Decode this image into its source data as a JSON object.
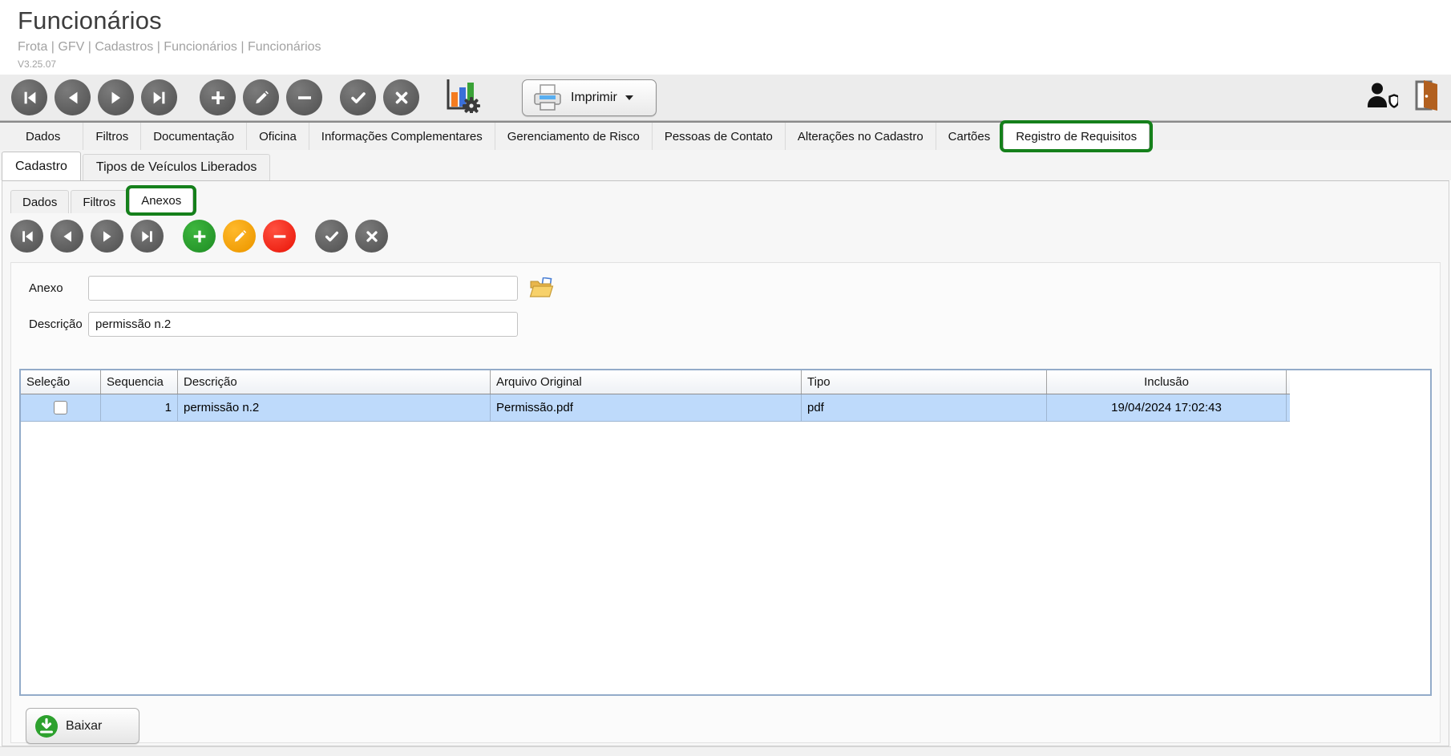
{
  "header": {
    "title": "Funcionários",
    "breadcrumb": "Frota | GFV | Cadastros | Funcionários | Funcionários",
    "version": "V3.25.07"
  },
  "toolbar": {
    "print_label": "Imprimir"
  },
  "main_tabs": {
    "items": [
      "Dados",
      "Filtros",
      "Documentação",
      "Oficina",
      "Informações Complementares",
      "Gerenciamento de Risco",
      "Pessoas de Contato",
      "Alterações no Cadastro",
      "Cartões",
      "Registro de Requisitos"
    ],
    "active": "Registro de Requisitos"
  },
  "sub_tabs": {
    "items": [
      "Cadastro",
      "Tipos de Veículos Liberados"
    ],
    "active": "Cadastro"
  },
  "inner_tabs": {
    "items": [
      "Dados",
      "Filtros",
      "Anexos"
    ],
    "active": "Anexos"
  },
  "form": {
    "anexo_label": "Anexo",
    "anexo_value": "",
    "descricao_label": "Descrição",
    "descricao_value": "permissão n.2"
  },
  "table": {
    "columns": [
      "Seleção",
      "Sequencia",
      "Descrição",
      "Arquivo Original",
      "Tipo",
      "Inclusão"
    ],
    "rows": [
      {
        "selected": false,
        "sequencia": "1",
        "descricao": "permissão n.2",
        "arquivo_original": "Permissão.pdf",
        "tipo": "pdf",
        "inclusao": "19/04/2024 17:02:43"
      }
    ]
  },
  "footer": {
    "download_label": "Baixar"
  },
  "icons": [
    "first-record-icon",
    "previous-record-icon",
    "next-record-icon",
    "last-record-icon",
    "add-icon",
    "edit-pencil-icon",
    "remove-icon",
    "confirm-check-icon",
    "cancel-x-icon",
    "chart-settings-icon",
    "printer-icon",
    "user-shield-icon",
    "exit-door-icon",
    "open-folder-icon",
    "download-icon"
  ],
  "colors": {
    "add_green": "#2da12e",
    "edit_orange": "#f7a30a",
    "delete_red": "#f32b1d",
    "row_highlight": "#bedafb",
    "annotation_green": "#15801b",
    "toolbar_gray": "#ececec"
  }
}
